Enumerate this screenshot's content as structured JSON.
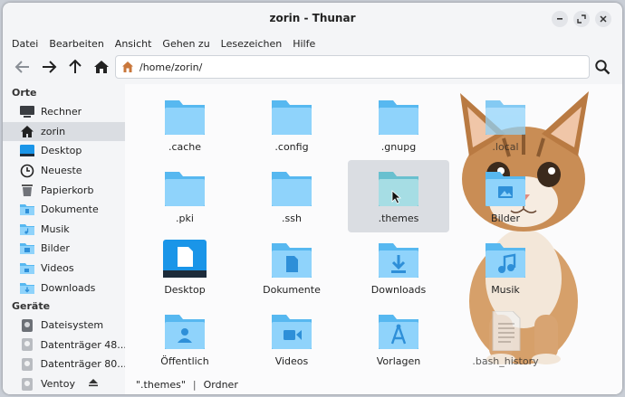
{
  "window": {
    "title": "zorin - Thunar"
  },
  "menu": [
    "Datei",
    "Bearbeiten",
    "Ansicht",
    "Gehen zu",
    "Lesezeichen",
    "Hilfe"
  ],
  "location": {
    "path": "/home/zorin/"
  },
  "sidebar": {
    "places_header": "Orte",
    "places": [
      {
        "label": "Rechner",
        "icon": "computer-icon"
      },
      {
        "label": "zorin",
        "icon": "home-icon"
      },
      {
        "label": "Desktop",
        "icon": "desktop-icon"
      },
      {
        "label": "Neueste",
        "icon": "clock-icon"
      },
      {
        "label": "Papierkorb",
        "icon": "trash-icon"
      },
      {
        "label": "Dokumente",
        "icon": "folder-documents-icon"
      },
      {
        "label": "Musik",
        "icon": "folder-music-icon"
      },
      {
        "label": "Bilder",
        "icon": "folder-pictures-icon"
      },
      {
        "label": "Videos",
        "icon": "folder-videos-icon"
      },
      {
        "label": "Downloads",
        "icon": "folder-downloads-icon"
      }
    ],
    "devices_header": "Geräte",
    "devices": [
      {
        "label": "Dateisystem",
        "icon": "drive-icon"
      },
      {
        "label": "Datenträger 48...",
        "icon": "drive-icon"
      },
      {
        "label": "Datenträger 80...",
        "icon": "drive-icon"
      },
      {
        "label": "Ventoy",
        "icon": "drive-icon"
      }
    ]
  },
  "files": [
    {
      "name": ".cache",
      "kind": "folder"
    },
    {
      "name": ".config",
      "kind": "folder"
    },
    {
      "name": ".gnupg",
      "kind": "folder"
    },
    {
      "name": ".local",
      "kind": "folder"
    },
    {
      "name": ".pki",
      "kind": "folder"
    },
    {
      "name": ".ssh",
      "kind": "folder"
    },
    {
      "name": ".themes",
      "kind": "folder",
      "selected": true
    },
    {
      "name": "Bilder",
      "kind": "folder-pictures"
    },
    {
      "name": "Desktop",
      "kind": "desktop"
    },
    {
      "name": "Dokumente",
      "kind": "folder-documents"
    },
    {
      "name": "Downloads",
      "kind": "folder-downloads"
    },
    {
      "name": "Musik",
      "kind": "folder-music"
    },
    {
      "name": "Öffentlich",
      "kind": "folder-public"
    },
    {
      "name": "Videos",
      "kind": "folder-videos"
    },
    {
      "name": "Vorlagen",
      "kind": "folder-templates"
    },
    {
      "name": ".bash_history",
      "kind": "text-file"
    }
  ],
  "status": {
    "selection": "\".themes\"",
    "type": "Ordner"
  },
  "colors": {
    "folder_back": "#57b8f0",
    "folder_front": "#8fd3fb",
    "folder_symbol": "#2e8fd8",
    "accent": "#1a95e8"
  }
}
